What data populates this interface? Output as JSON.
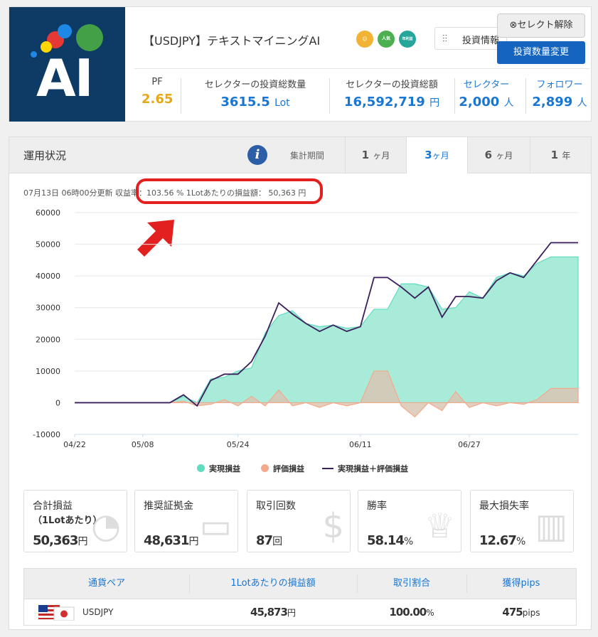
{
  "header": {
    "logo_text": "AI",
    "title": "【USDJPY】テキストマイニングAI",
    "badges": [
      "人気TOP10",
      "年利益TOP10"
    ],
    "info_button": "投資情報",
    "clear_button": "⊗セレクト解除",
    "change_button": "投資数量変更",
    "stats": [
      {
        "label": "PF",
        "value": "2.65",
        "unit": ""
      },
      {
        "label": "セレクターの投資総数量",
        "value": "3615.5",
        "unit": "Lot"
      },
      {
        "label": "セレクターの投資総額",
        "value": "16,592,719",
        "unit": "円"
      },
      {
        "label": "セレクター",
        "value": "2,000",
        "unit": "人"
      },
      {
        "label": "フォロワー",
        "value": "2,899",
        "unit": "人"
      }
    ]
  },
  "panel": {
    "title": "運用状況",
    "period_label": "集計期間",
    "tabs": [
      {
        "num": "1",
        "unit": "ヶ月",
        "active": false
      },
      {
        "num": "3",
        "unit": "ヶ月",
        "active": true
      },
      {
        "num": "6",
        "unit": "ヶ月",
        "active": false
      },
      {
        "num": "1",
        "unit": "年",
        "active": false
      }
    ],
    "update_text": "07月13日 06時00分更新 収益率：103.56 % 1Lotあたりの損益額： 50,363 円"
  },
  "chart_data": {
    "type": "area",
    "x": [
      "04/22",
      "04/25",
      "04/28",
      "05/01",
      "05/04",
      "05/08",
      "05/11",
      "05/14",
      "05/17",
      "05/19",
      "05/21",
      "05/22",
      "05/24",
      "05/26",
      "05/28",
      "05/30",
      "06/01",
      "06/03",
      "06/05",
      "06/07",
      "06/09",
      "06/11",
      "06/13",
      "06/15",
      "06/17",
      "06/19",
      "06/21",
      "06/23",
      "06/25",
      "06/27",
      "06/29",
      "07/01",
      "07/03",
      "07/05",
      "07/07",
      "07/09",
      "07/11",
      "07/13"
    ],
    "xticks": [
      "04/22",
      "05/08",
      "05/24",
      "06/11",
      "06/27"
    ],
    "ylim": [
      -10000,
      60000
    ],
    "yticks": [
      -10000,
      0,
      10000,
      20000,
      30000,
      40000,
      50000,
      60000
    ],
    "series": [
      {
        "name": "実現損益",
        "color": "#a8ebd9",
        "values": [
          0,
          0,
          0,
          0,
          0,
          0,
          0,
          0,
          2000,
          0,
          7500,
          8000,
          10000,
          11000,
          22000,
          27500,
          29000,
          25000,
          24000,
          24500,
          23500,
          24000,
          29500,
          29500,
          37500,
          37500,
          36500,
          29500,
          30000,
          35000,
          33000,
          39500,
          41000,
          40000,
          44000,
          46000,
          46000,
          46000
        ]
      },
      {
        "name": "評価損益",
        "color": "#d8c7b4",
        "values": [
          0,
          0,
          0,
          0,
          0,
          0,
          0,
          0,
          500,
          -1000,
          -500,
          1000,
          -1000,
          2000,
          -1000,
          4000,
          -1000,
          0,
          -1500,
          0,
          -1000,
          0,
          10000,
          10000,
          -1000,
          -4500,
          0,
          -2500,
          3500,
          -1500,
          0,
          -1000,
          0,
          -500,
          1000,
          4500,
          4500,
          4500
        ]
      },
      {
        "name": "実現損益＋評価損益",
        "color": "#3a1f5d",
        "values": [
          0,
          0,
          0,
          0,
          0,
          0,
          0,
          0,
          2500,
          -1000,
          7000,
          9000,
          9000,
          13000,
          21000,
          31500,
          28000,
          25000,
          22500,
          24500,
          22500,
          24000,
          39500,
          39500,
          36500,
          33000,
          36500,
          27000,
          33500,
          33500,
          33000,
          38500,
          41000,
          39500,
          45000,
          50500,
          50500,
          50500
        ]
      }
    ]
  },
  "cards": [
    {
      "label": "合計損益",
      "sublabel": "（1Lotあたり）",
      "value": "50,363",
      "unit": "円"
    },
    {
      "label": "推奨証拠金",
      "sublabel": "",
      "value": "48,631",
      "unit": "円"
    },
    {
      "label": "取引回数",
      "sublabel": "",
      "value": "87",
      "unit": "回"
    },
    {
      "label": "勝率",
      "sublabel": "",
      "value": "58.14",
      "unit": "%"
    },
    {
      "label": "最大損失率",
      "sublabel": "",
      "value": "12.67",
      "unit": "%"
    }
  ],
  "table": {
    "headers": [
      "通貨ペア",
      "1Lotあたりの損益額",
      "取引割合",
      "獲得pips"
    ],
    "row": {
      "pair": "USDJPY",
      "pnl": "45,873",
      "pnl_unit": "円",
      "ratio": "100.00",
      "ratio_unit": "%",
      "pips": "475",
      "pips_unit": "pips"
    }
  }
}
